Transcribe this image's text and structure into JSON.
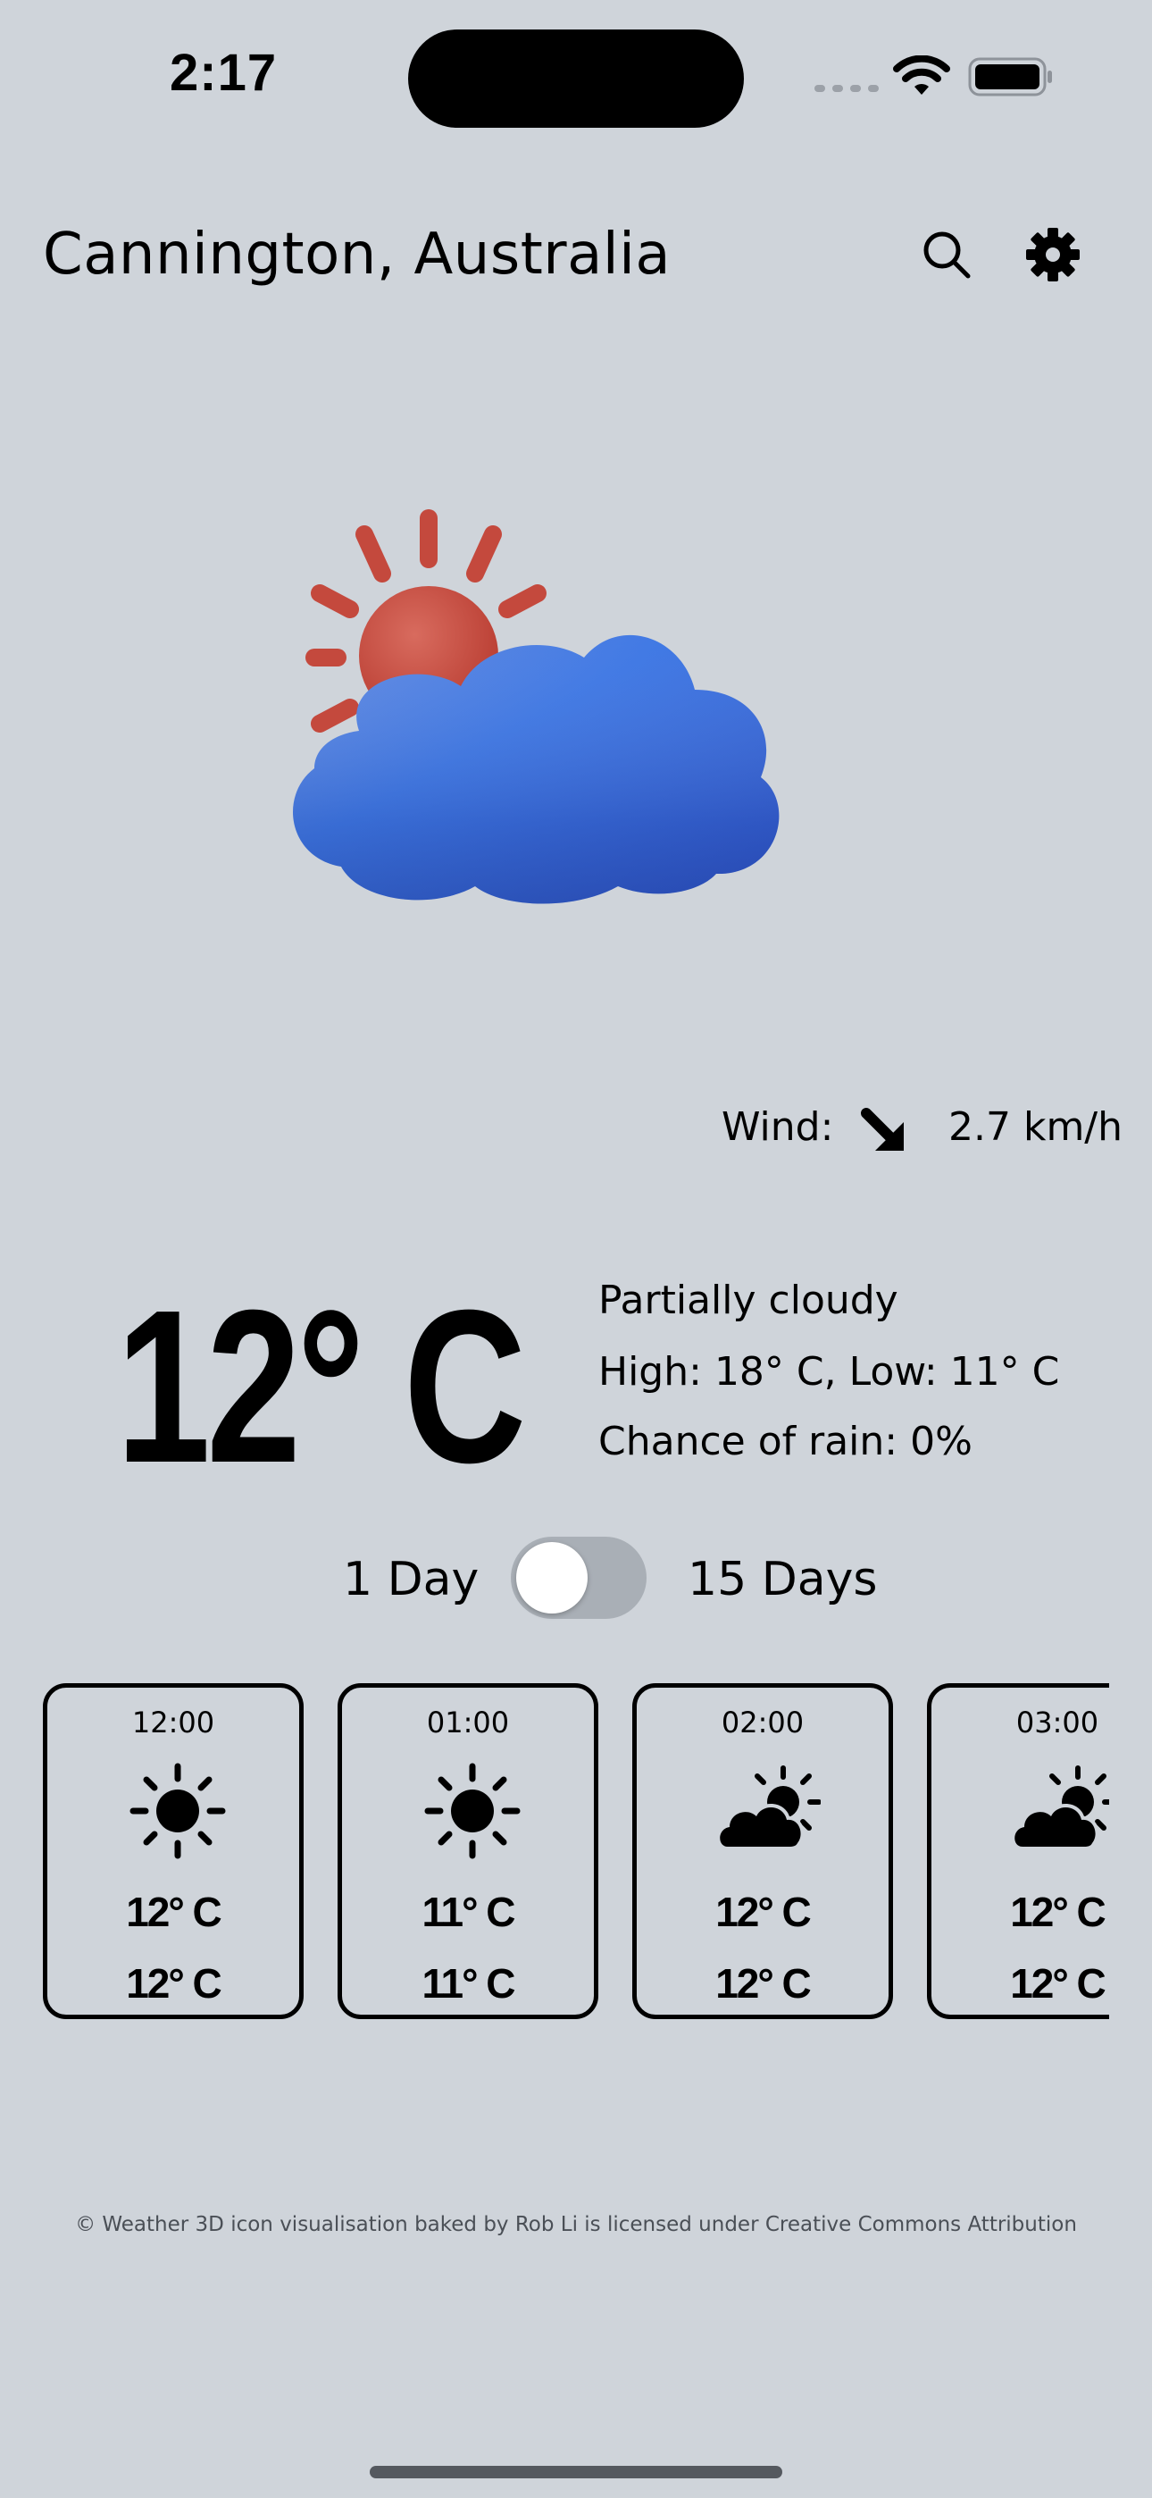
{
  "status_bar": {
    "time": "2:17",
    "signal_icon": "cellular-signal-icon",
    "wifi_icon": "wifi-icon",
    "battery_icon": "battery-icon"
  },
  "header": {
    "location": "Cannington, Australia",
    "search_icon": "search-icon",
    "settings_icon": "gear-icon"
  },
  "hero": {
    "icon": "partly-cloudy-3d-icon",
    "colors": {
      "sun": "#c8473b",
      "cloud": "#3f6fe0"
    }
  },
  "wind": {
    "label": "Wind:",
    "direction_icon": "arrow-down-right-icon",
    "speed": "2.7 km/h"
  },
  "current": {
    "temperature": "12° C",
    "description": "Partially cloudy",
    "high_low": "High: 18° C, Low: 11° C",
    "rain": "Chance of rain: 0%"
  },
  "forecast_toggle": {
    "left_label": "1 Day",
    "right_label": "15 Days",
    "state": "1 Day"
  },
  "hourly": [
    {
      "time": "12:00",
      "icon": "sun-icon",
      "temp": "12° C",
      "feels": "12° C"
    },
    {
      "time": "01:00",
      "icon": "sun-icon",
      "temp": "11° C",
      "feels": "11° C"
    },
    {
      "time": "02:00",
      "icon": "partly-cloudy-icon",
      "temp": "12° C",
      "feels": "12° C"
    },
    {
      "time": "03:00",
      "icon": "partly-cloudy-icon",
      "temp": "12° C",
      "feels": "12° C"
    }
  ],
  "footer": {
    "attribution": "© Weather 3D icon visualisation baked by Rob Li is licensed under Creative Commons Attribution"
  }
}
